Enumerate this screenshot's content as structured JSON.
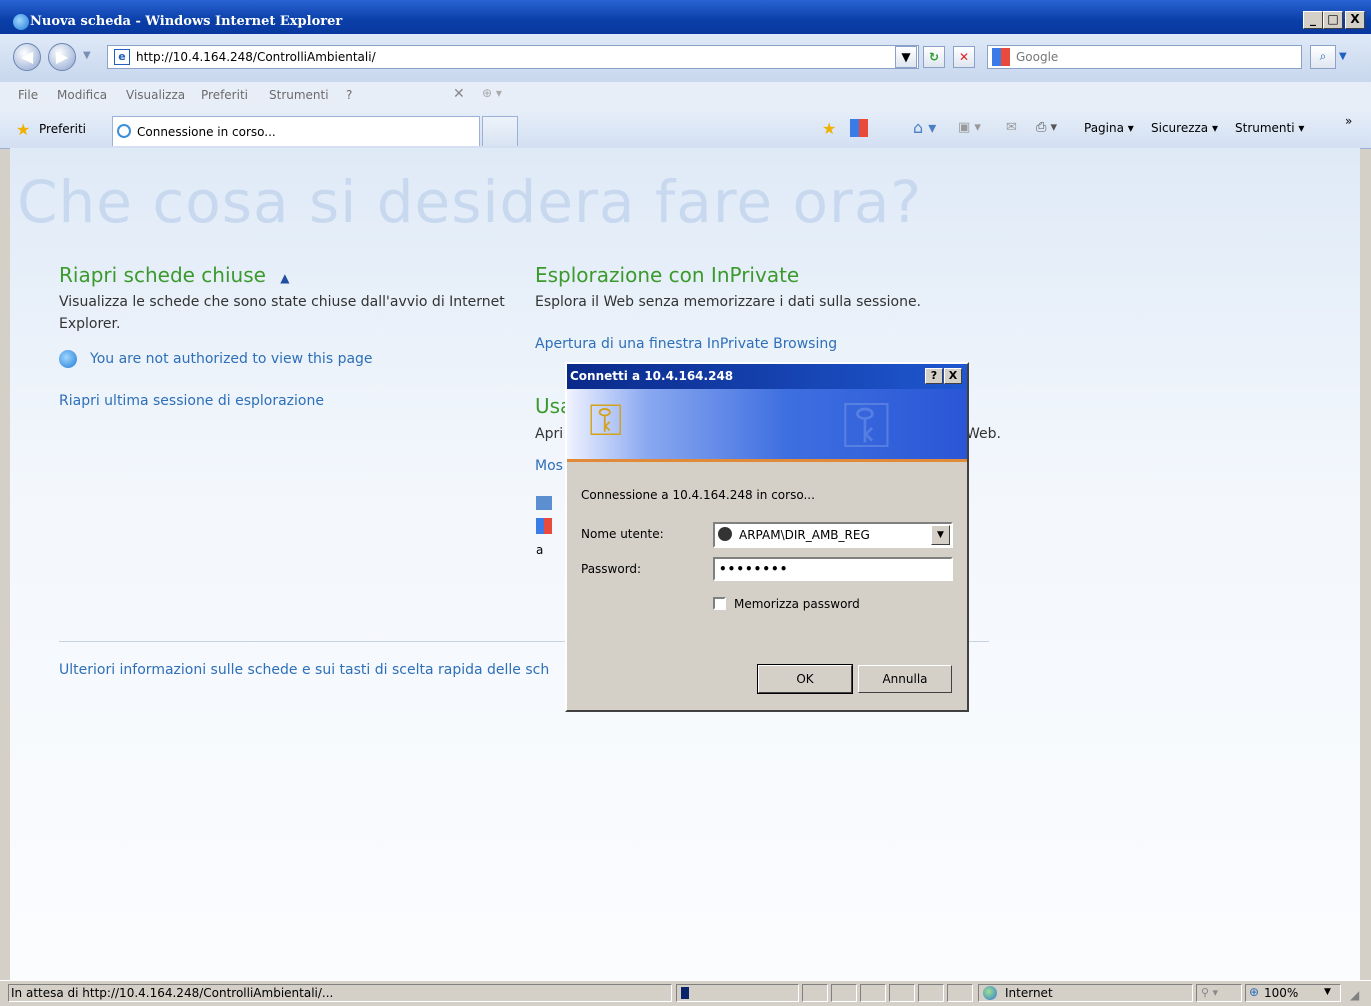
{
  "window": {
    "title": "Nuova scheda - Windows Internet Explorer",
    "controls": [
      "_",
      "□",
      "X"
    ]
  },
  "address_bar": {
    "url": "http://10.4.164.248/ControlliAmbientali/",
    "search_placeholder": "Google"
  },
  "menu": {
    "items": [
      "File",
      "Modifica",
      "Visualizza",
      "Preferiti",
      "Strumenti",
      "?"
    ]
  },
  "favorites_bar": {
    "favorites_label": "Preferiti",
    "tab_label": "Connessione in corso...",
    "commands": [
      "Pagina ▾",
      "Sicurezza ▾",
      "Strumenti ▾"
    ]
  },
  "content": {
    "big_title": "Che cosa si desidera fare ora?",
    "left": {
      "heading": "Riapri schede chiuse",
      "description": "Visualizza le schede che sono state chiuse dall'avvio di Internet Explorer.",
      "closed_tab_link": "You are not authorized to view this page",
      "reopen_session_link": "Riapri ultima sessione di esplorazione"
    },
    "right": {
      "heading": "Esplorazione con InPrivate",
      "description": "Esplora il Web senza memorizzare i dati sulla sessione.",
      "inprivate_link": "Apertura di una finestra InPrivate Browsing",
      "heading2_partial": "Usa",
      "desc2_partial": "Apri",
      "desc2_end": "Web.",
      "link2_partial": "Mos"
    },
    "footer_link": "Ulteriori informazioni sulle schede e sui tasti di scelta rapida delle sch"
  },
  "dialog": {
    "title": "Connetti a 10.4.164.248",
    "help_button": "?",
    "close_button": "X",
    "connecting_text": "Connessione a 10.4.164.248 in corso...",
    "username_label": "Nome utente:",
    "username_value": "ARPAM\\DIR_AMB_REG",
    "password_label": "Password:",
    "password_value": "••••••••",
    "remember_label": "Memorizza password",
    "ok_label": "OK",
    "cancel_label": "Annulla"
  },
  "status_bar": {
    "text": "In attesa di http://10.4.164.248/ControlliAmbientali/...",
    "zone": "Internet",
    "zoom": "100%"
  }
}
